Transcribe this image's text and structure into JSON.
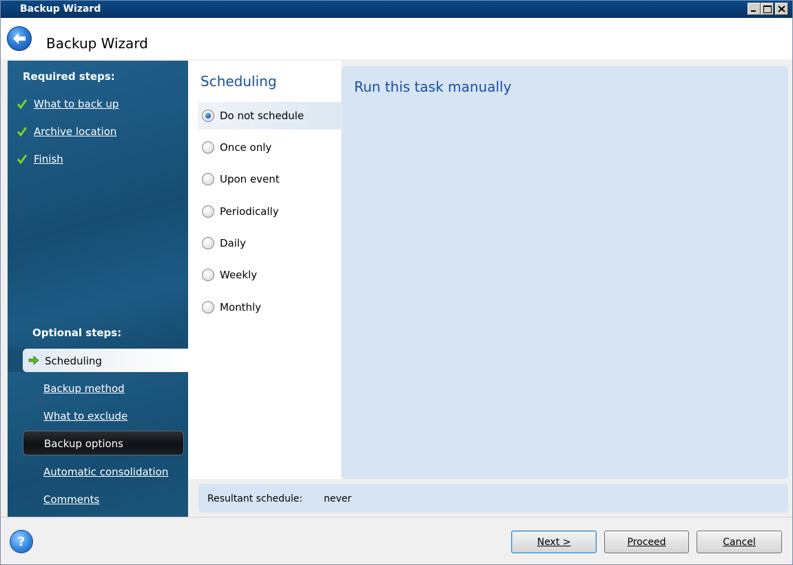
{
  "window": {
    "title": "Backup Wizard",
    "header_title": "Backup Wizard"
  },
  "sidebar": {
    "required_title": "Required steps:",
    "required_steps": [
      {
        "label": "What to back up",
        "done": true
      },
      {
        "label": "Archive location",
        "done": true
      },
      {
        "label": "Finish",
        "done": true
      }
    ],
    "optional_title": "Optional steps:",
    "optional_steps": [
      {
        "label": "Scheduling",
        "state": "current"
      },
      {
        "label": "Backup method",
        "state": "link"
      },
      {
        "label": "What to exclude",
        "state": "link"
      },
      {
        "label": "Backup options",
        "state": "hover"
      },
      {
        "label": "Automatic consolidation",
        "state": "link"
      },
      {
        "label": "Comments",
        "state": "link"
      }
    ]
  },
  "scheduling": {
    "title": "Scheduling",
    "selected": "Do not schedule",
    "options": [
      "Do not schedule",
      "Once only",
      "Upon event",
      "Periodically",
      "Daily",
      "Weekly",
      "Monthly"
    ]
  },
  "detail": {
    "title": "Run this task manually"
  },
  "result": {
    "label": "Resultant schedule:",
    "value": "never"
  },
  "buttons": {
    "next": "Next >",
    "proceed": "Proceed",
    "cancel": "Cancel",
    "help": "?"
  },
  "colors": {
    "titlebar": "#0a3f76",
    "sidebar": "#174d72",
    "accent_text": "#1a4fa0",
    "panel": "#d6e4f3"
  },
  "icons": {
    "back": "back-arrow-icon",
    "check": "checkmark-icon",
    "current": "green-arrow-icon",
    "help": "help-icon"
  }
}
